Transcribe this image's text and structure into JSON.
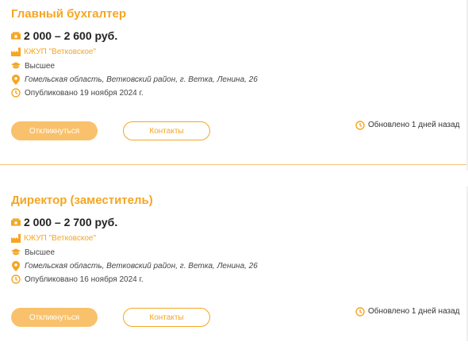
{
  "vacancies": [
    {
      "title": "Главный бухгалтер",
      "salary": "2 000 – 2 600 руб.",
      "company": "КЖУП \"Ветковское\"",
      "education": "Высшее",
      "address": "Гомельская область, Ветковский район, г. Ветка, Ленина, 26",
      "published": "Опубликовано 19 ноября 2024 г.",
      "respond_label": "Откликнуться",
      "contacts_label": "Контакты",
      "updated": "Обновлено 1 дней назад"
    },
    {
      "title": "Директор (заместитель)",
      "salary": "2 000 – 2 700 руб.",
      "company": "КЖУП \"Ветковское\"",
      "education": "Высшее",
      "address": "Гомельская область, Ветковский район, г. Ветка, Ленина, 26",
      "published": "Опубликовано 16 ноября 2024 г.",
      "respond_label": "Откликнуться",
      "contacts_label": "Контакты",
      "updated": "Обновлено 1 дней назад"
    }
  ],
  "icons": {
    "salary": "money-icon",
    "company": "factory-icon",
    "education": "graduation-cap-icon",
    "address": "location-pin-icon",
    "published": "clock-icon",
    "updated": "clock-icon"
  },
  "colors": {
    "accent": "#f5a623",
    "button_fill": "#f9c16b",
    "divider": "#f5c27a"
  }
}
